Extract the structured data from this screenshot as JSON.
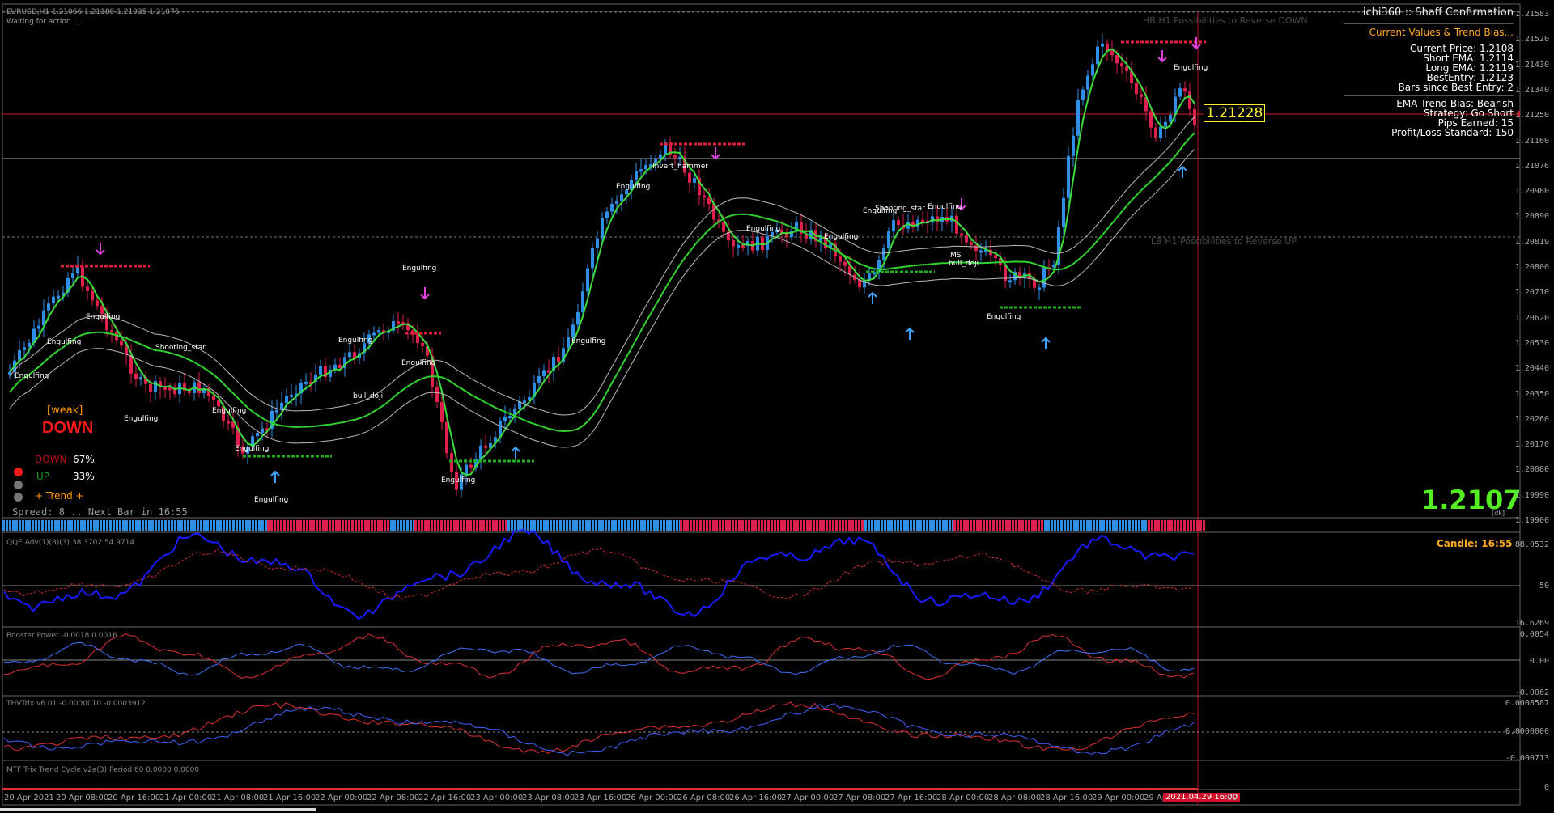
{
  "header": {
    "symbol_line": "EURUSD,H1  1.21066 1.21189 1.21035 1.21076",
    "status": "Waiting for action ..."
  },
  "overlay": {
    "hb_text": "HB  H1 Possibilities to Reverse DOWN",
    "lb_text": "LB  H1 Possibilities to Reverse UP",
    "strength_label": "[weak]",
    "direction_label": "DOWN",
    "down_label": "DOWN",
    "down_pct": "67%",
    "up_label": "UP",
    "up_pct": "33%",
    "trend_label": "+   Trend   +",
    "spread_line": "Spread: 8 .. Next Bar in 16:55",
    "price_marker": "1.21228",
    "big_price": "1.2107",
    "dk_tag": "[dk]"
  },
  "info_panel": {
    "title": "ichi360 :: Shaff Confirmation",
    "subtitle": "Current Values & Trend Bias...",
    "lines": [
      "Current Price: 1.2108",
      "Short EMA: 1.2114",
      "Long EMA: 1.2119",
      "BestEntry: 1.2123",
      "Bars since Best Entry: 2"
    ],
    "lines2": [
      "EMA Trend Bias: Bearish",
      "Strategy:  Go Short",
      "Pips Earned: 15",
      "Profit/Loss Standard: 150"
    ]
  },
  "patterns": [
    "Engulfing",
    "Engulfing",
    "Engulfing",
    "Shooting_star",
    "Engulfing",
    "Engulfing",
    "Engulfing",
    "Engulfing",
    "Engulfing",
    "Engulfing",
    "bull_doji",
    "Engulfing",
    "Engulfing",
    "Engulfing",
    "Invert_hammer",
    "Engulfing",
    "Engulfing",
    "Engulfing",
    "Engulfing",
    "Shooting_star",
    "Engulfing",
    "MS",
    "bull_doji",
    "Engulfing",
    "Engulfing"
  ],
  "price_scale": [
    "1.21583",
    "1.21520",
    "1.21430",
    "1.21340",
    "1.21250",
    "1.21160",
    "1.21076",
    "1.20980",
    "1.20890",
    "1.20819",
    "1.20800",
    "1.20710",
    "1.20620",
    "1.20530",
    "1.20440",
    "1.20350",
    "1.20260",
    "1.20170",
    "1.20080",
    "1.19990",
    "1.19900"
  ],
  "subwindows": {
    "strip_label": "",
    "qqe": {
      "label": "QQE Adv(1)(8)(3) 38.3702 54.9714",
      "candle": "Candle:  16:55",
      "scale": [
        "88.0532",
        "50",
        "16.6269"
      ]
    },
    "booster": {
      "label": "Booster Power -0.0018 0.0016",
      "scale": [
        "0.0054",
        "0.00",
        "-0.0062"
      ]
    },
    "thv": {
      "label": "THVTrix v6.01 -0.0000010 -0.0003912",
      "scale": [
        "0.0008587",
        "0.0000000",
        "-0.000713"
      ]
    },
    "mtf": {
      "label": "MTF Trix Trend Cycle v2a(3) Period 60 0.0000 0.0000",
      "scale": [
        "0"
      ]
    }
  },
  "time_axis": [
    "20 Apr 2021",
    "20 Apr 08:00",
    "20 Apr 16:00",
    "21 Apr 00:00",
    "21 Apr 08:00",
    "21 Apr 16:00",
    "22 Apr 00:00",
    "22 Apr 08:00",
    "22 Apr 16:00",
    "23 Apr 00:00",
    "23 Apr 08:00",
    "23 Apr 16:00",
    "26 Apr 00:00",
    "26 Apr 08:00",
    "26 Apr 16:00",
    "27 Apr 00:00",
    "27 Apr 08:00",
    "27 Apr 16:00",
    "28 Apr 00:00",
    "28 Apr 08:00",
    "28 Apr 16:00",
    "29 Apr 00:00",
    "29 Ap"
  ],
  "time_current": "2021.04.29 16:00",
  "time_tail": "00",
  "colors": {
    "bull": "#2f8fe6",
    "bear": "#e0204c",
    "fast_ma": "#3cdc3c",
    "slow_ma": "#30d030",
    "envelope": "#bbbbbb",
    "accent": "#ffaa22"
  }
}
